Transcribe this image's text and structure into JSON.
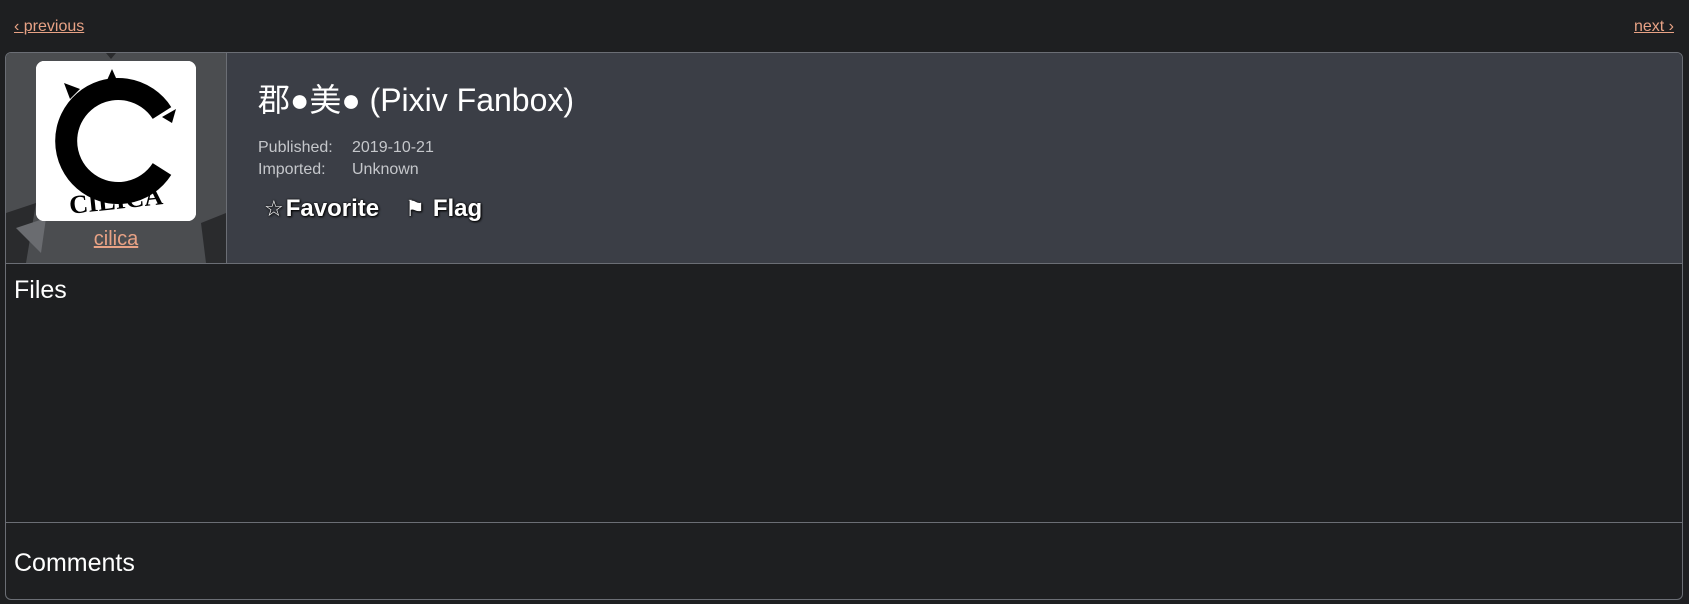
{
  "nav": {
    "previous_label": "‹ previous",
    "next_label": "next ›"
  },
  "user": {
    "name": "cilica",
    "avatar_text": "CILICA"
  },
  "post": {
    "title": "郡●美● (Pixiv Fanbox)",
    "published_label": "Published:",
    "published_value": "2019-10-21",
    "imported_label": "Imported:",
    "imported_value": "Unknown"
  },
  "actions": {
    "favorite_icon": "☆",
    "favorite_label": "Favorite",
    "flag_icon": "⚑",
    "flag_label": "Flag"
  },
  "sections": {
    "files_title": "Files",
    "comments_title": "Comments"
  },
  "colors": {
    "link": "#e8a285",
    "header_bg": "#3b3e46",
    "page_bg": "#1e1f21",
    "border": "#6b6e75"
  }
}
